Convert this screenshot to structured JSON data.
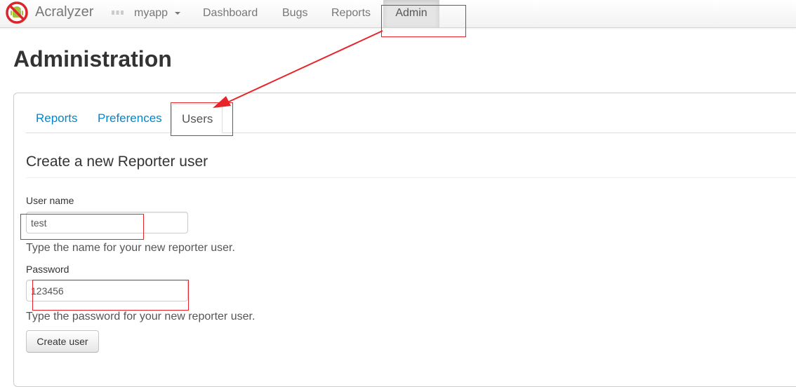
{
  "navbar": {
    "brand": "Acralyzer",
    "brand_icon": "no-android-icon",
    "app_switcher": "myapp",
    "items": [
      {
        "label": "Dashboard",
        "active": false
      },
      {
        "label": "Bugs",
        "active": false
      },
      {
        "label": "Reports",
        "active": false
      },
      {
        "label": "Admin",
        "active": true
      }
    ]
  },
  "page": {
    "title": "Administration"
  },
  "tabs": [
    {
      "label": "Reports",
      "active": false
    },
    {
      "label": "Preferences",
      "active": false
    },
    {
      "label": "Users",
      "active": true
    }
  ],
  "form": {
    "title": "Create a new Reporter user",
    "username": {
      "label": "User name",
      "value": "test",
      "help": "Type the name for your new reporter user."
    },
    "password": {
      "label": "Password",
      "value": "123456",
      "help": "Type the password for your new reporter user."
    },
    "submit_label": "Create user"
  },
  "colors": {
    "link": "#0088cc",
    "annotation": "#e8242b",
    "logo_red": "#d9262b",
    "logo_green": "#9fc33b"
  }
}
